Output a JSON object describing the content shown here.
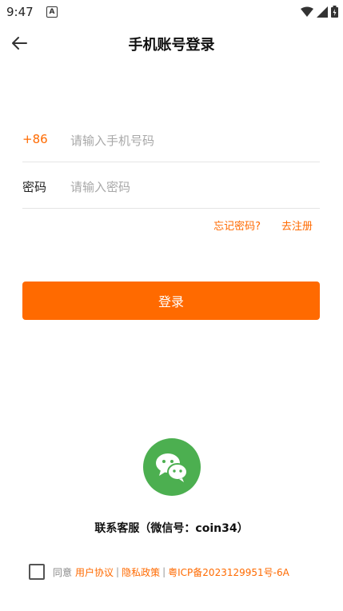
{
  "status": {
    "time": "9:47",
    "notif_letter": "A"
  },
  "header": {
    "title": "手机账号登录"
  },
  "phone": {
    "prefix": "+86",
    "placeholder": "请输入手机号码",
    "value": ""
  },
  "password": {
    "label": "密码",
    "placeholder": "请输入密码",
    "value": ""
  },
  "links": {
    "forgot": "忘记密码?",
    "register": "去注册"
  },
  "login_button": "登录",
  "contact": {
    "text": "联系客服（微信号：coin34）"
  },
  "agreement": {
    "prefix": "同意",
    "user_agreement": "用户协议",
    "separator": "|",
    "privacy": "隐私政策",
    "icp": "粤ICP备2023129951号-6A"
  },
  "colors": {
    "accent": "#ff6a00",
    "wechat": "#4caf50"
  }
}
